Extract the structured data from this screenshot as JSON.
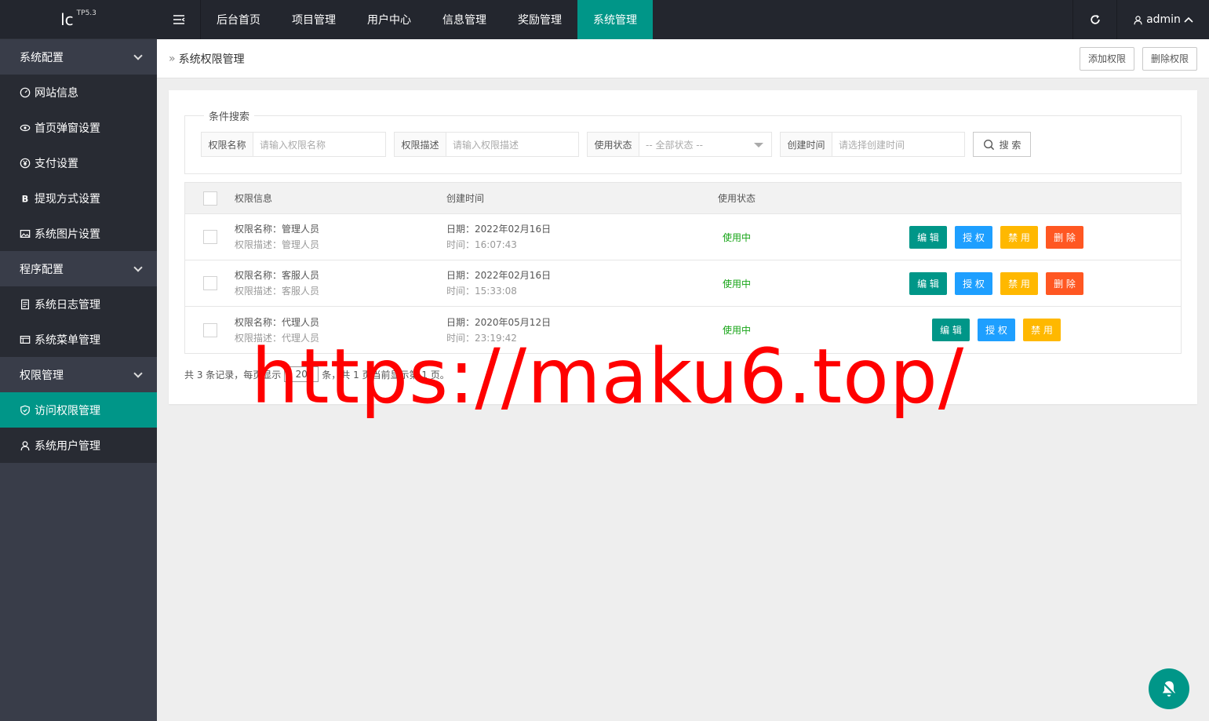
{
  "logo": {
    "text": "lc",
    "sup": "TP5.3"
  },
  "header": {
    "nav": [
      "后台首页",
      "项目管理",
      "用户中心",
      "信息管理",
      "奖励管理",
      "系统管理"
    ],
    "active_index": 5,
    "user": "admin"
  },
  "sidebar": {
    "groups": [
      {
        "label": "系统配置",
        "items": [
          {
            "label": "网站信息",
            "icon": "dashboard-icon"
          },
          {
            "label": "首页弹窗设置",
            "icon": "eye-icon"
          },
          {
            "label": "支付设置",
            "icon": "yen-icon"
          },
          {
            "label": "提现方式设置",
            "icon": "bitcoin-icon"
          },
          {
            "label": "系统图片设置",
            "icon": "image-icon"
          }
        ]
      },
      {
        "label": "程序配置",
        "items": [
          {
            "label": "系统日志管理",
            "icon": "log-icon"
          },
          {
            "label": "系统菜单管理",
            "icon": "menu-icon"
          }
        ]
      },
      {
        "label": "权限管理",
        "items": [
          {
            "label": "访问权限管理",
            "icon": "shield-icon"
          },
          {
            "label": "系统用户管理",
            "icon": "user-icon"
          }
        ]
      }
    ],
    "active_item": "访问权限管理"
  },
  "breadcrumb": {
    "current": "系统权限管理"
  },
  "actions": {
    "add": "添加权限",
    "delete": "删除权限"
  },
  "search": {
    "legend": "条件搜索",
    "fields": [
      {
        "label": "权限名称",
        "placeholder": "请输入权限名称"
      },
      {
        "label": "权限描述",
        "placeholder": "请输入权限描述"
      },
      {
        "label": "使用状态",
        "placeholder": "-- 全部状态 --"
      },
      {
        "label": "创建时间",
        "placeholder": "请选择创建时间"
      }
    ],
    "button": "搜 索"
  },
  "table": {
    "headers": [
      "权限信息",
      "创建时间",
      "使用状态"
    ],
    "rows": [
      {
        "name": "权限名称：管理人员",
        "desc": "权限描述：管理人员",
        "date": "日期：2022年02月16日",
        "time": "时间：16:07:43",
        "status": "使用中",
        "ops": [
          "编 辑",
          "授 权",
          "禁 用",
          "删 除"
        ]
      },
      {
        "name": "权限名称：客服人员",
        "desc": "权限描述：客服人员",
        "date": "日期：2022年02月16日",
        "time": "时间：15:33:08",
        "status": "使用中",
        "ops": [
          "编 辑",
          "授 权",
          "禁 用",
          "删 除"
        ]
      },
      {
        "name": "权限名称：代理人员",
        "desc": "权限描述：代理人员",
        "date": "日期：2020年05月12日",
        "time": "时间：23:19:42",
        "status": "使用中",
        "ops": [
          "编 辑",
          "授 权",
          "禁 用"
        ]
      }
    ]
  },
  "pager": {
    "prefix": "共 3 条记录，每页显示",
    "size": "20",
    "suffix": "条，共 1 页当前显示第 1 页。"
  },
  "watermark": "https://maku6.top/",
  "colors": {
    "accent": "#009688",
    "blue": "#1e9fff",
    "yellow": "#ffb800",
    "red": "#ff5722"
  }
}
